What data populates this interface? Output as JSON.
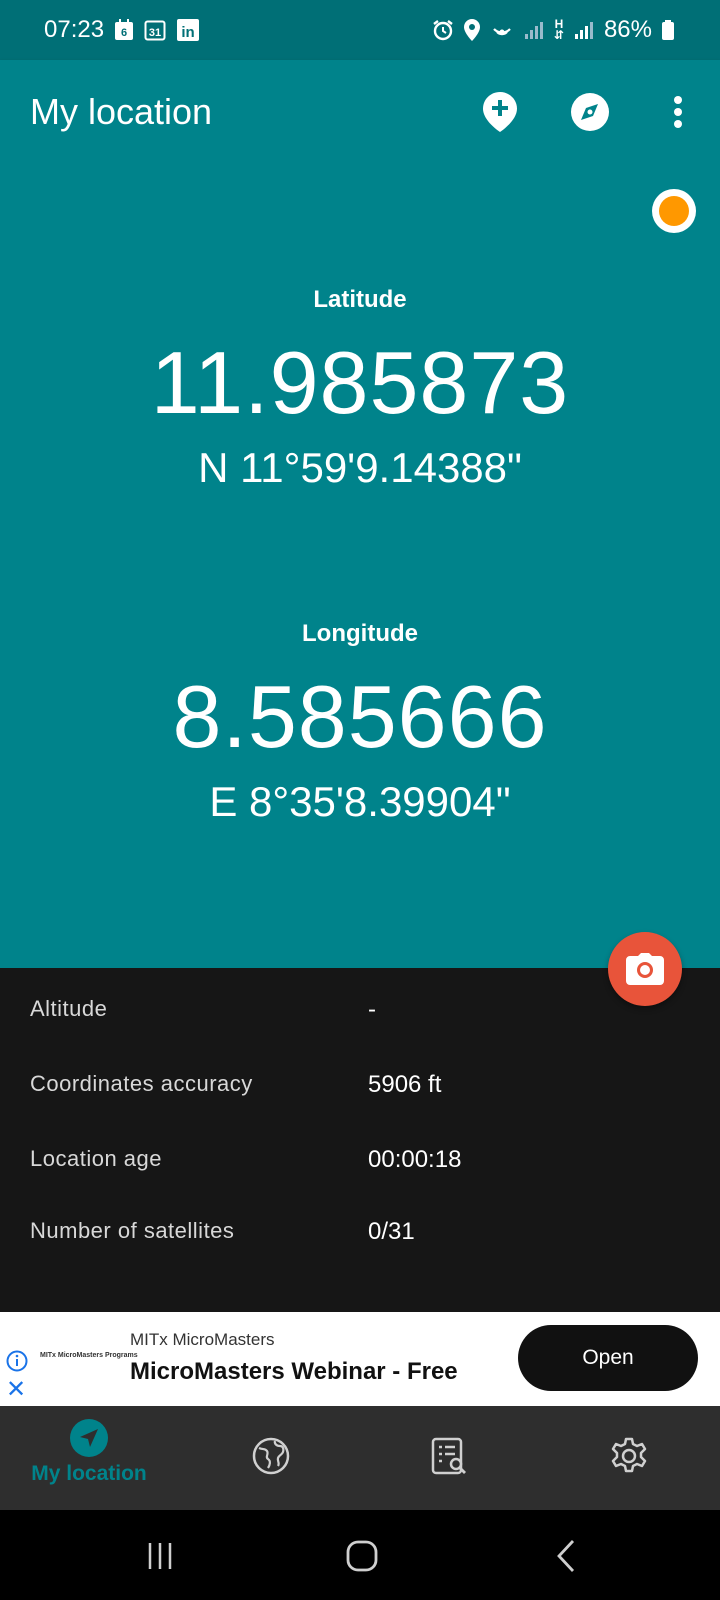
{
  "status_bar": {
    "time": "07:23",
    "calendar_badge": "6",
    "date_badge": "31",
    "linkedin_badge": "in",
    "network_type": "H",
    "battery": "86%"
  },
  "app_bar": {
    "title": "My location",
    "actions": [
      "add-location-icon",
      "compass-icon",
      "more-vert-icon"
    ]
  },
  "gps_indicator": {
    "color": "#ff9800"
  },
  "latitude": {
    "label": "Latitude",
    "decimal": "11.985873",
    "dms": "N 11°59'9.14388\""
  },
  "longitude": {
    "label": "Longitude",
    "decimal": "8.585666",
    "dms": "E 8°35'8.39904\""
  },
  "details": [
    {
      "label": "Altitude",
      "value": "-"
    },
    {
      "label": "Coordinates accuracy",
      "value": "5906 ft"
    },
    {
      "label": "Location age",
      "value": "00:00:18"
    },
    {
      "label": "Number of satellites",
      "value": "0/31"
    }
  ],
  "ad": {
    "logo_text": "MITx MicroMasters Programs",
    "brand": "MITx MicroMasters",
    "headline": "MicroMasters Webinar - Free",
    "cta": "Open"
  },
  "bottom_nav": {
    "items": [
      {
        "label": "My location",
        "icon": "navigation-arrow-icon",
        "active": true
      },
      {
        "label": "",
        "icon": "globe-icon",
        "active": false
      },
      {
        "label": "",
        "icon": "list-search-icon",
        "active": false
      },
      {
        "label": "",
        "icon": "settings-gear-icon",
        "active": false
      }
    ]
  },
  "colors": {
    "primary": "#00838b",
    "status_bar": "#006f76",
    "fab": "#e8543a",
    "background": "#161616"
  }
}
